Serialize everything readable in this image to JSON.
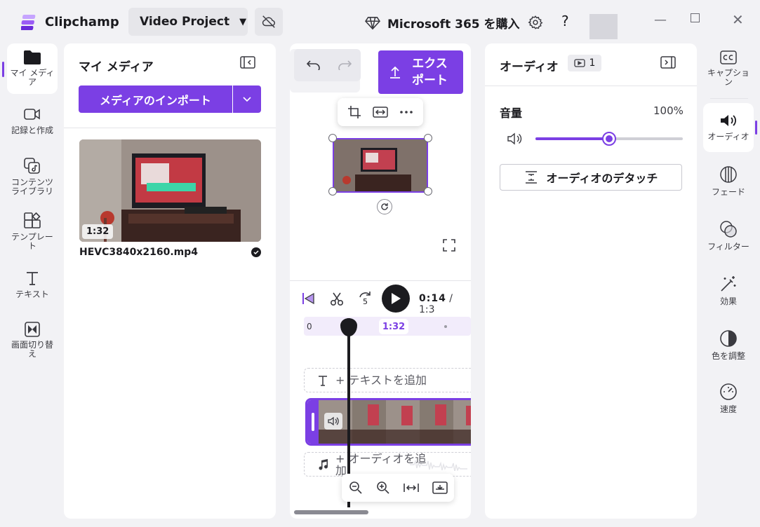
{
  "app": {
    "name": "Clipchamp",
    "project_title": "Video Project",
    "m365_label": "Microsoft 365 を購入",
    "help": "?"
  },
  "left_rail": [
    {
      "label": "マイ メディア",
      "icon": "folder-icon"
    },
    {
      "label": "記録と作成",
      "icon": "camera-icon"
    },
    {
      "label": "コンテンツ ライブラリ",
      "icon": "library-icon"
    },
    {
      "label": "テンプレート",
      "icon": "templates-icon"
    },
    {
      "label": "テキスト",
      "icon": "text-icon"
    },
    {
      "label": "画面切り替え",
      "icon": "transition-icon"
    }
  ],
  "media": {
    "title": "マイ メディア",
    "import_label": "メディアのインポート",
    "item": {
      "duration": "1:32",
      "filename": "HEVC3840x2160.mp4"
    }
  },
  "preview": {
    "export_label_1": "エクス",
    "export_label_2": "ポート",
    "current_time": "0:14",
    "total_time": " / 1:3",
    "ruler_start": "0",
    "ruler_marker": "1:32",
    "skip_label": "5",
    "text_track_label": "+ テキストを追加",
    "audio_track_label": "+ オーディオを追加"
  },
  "audio": {
    "title": "オーディオ",
    "clip_count": "1",
    "volume_label": "音量",
    "volume_value": "100%",
    "volume_level": 0.5,
    "detach_label": "オーディオのデタッチ"
  },
  "right_rail": [
    {
      "label": "キャプション",
      "icon": "captions-icon"
    },
    {
      "label": "オーディオ",
      "icon": "speaker-icon"
    },
    {
      "label": "フェード",
      "icon": "fade-icon"
    },
    {
      "label": "フィルター",
      "icon": "filter-icon"
    },
    {
      "label": "効果",
      "icon": "effects-wand-icon"
    },
    {
      "label": "色を調整",
      "icon": "color-adjust-icon"
    },
    {
      "label": "速度",
      "icon": "speed-gauge-icon"
    }
  ],
  "colors": {
    "accent": "#7b3fe4",
    "background": "#f2f2f5",
    "panel": "#ffffff"
  }
}
